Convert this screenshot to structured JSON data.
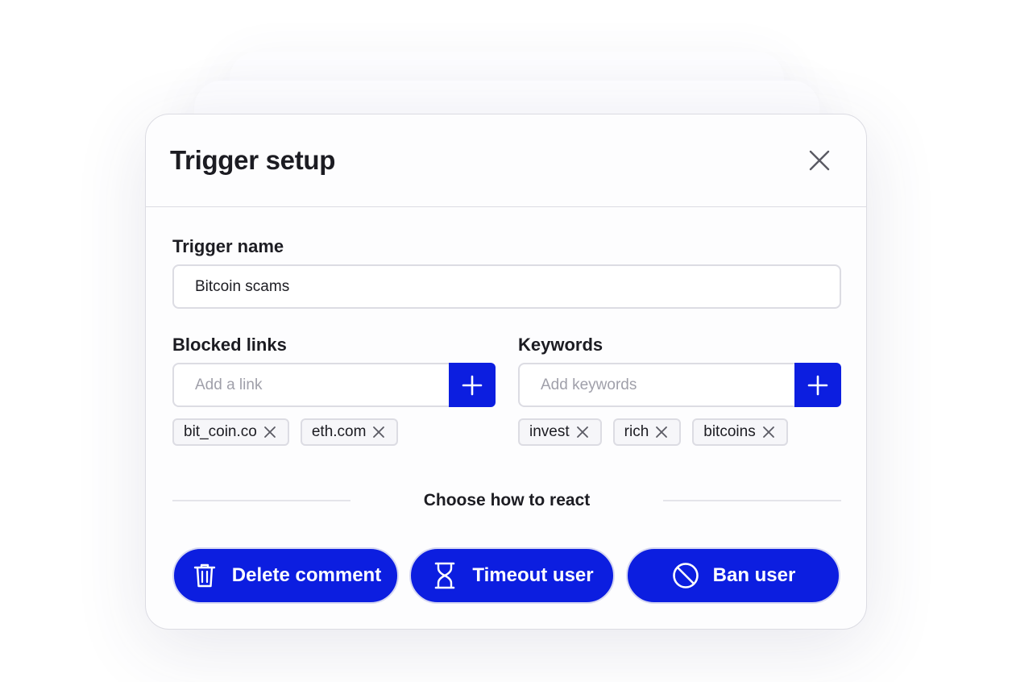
{
  "dialog": {
    "title": "Trigger setup",
    "close_icon": "close-icon"
  },
  "trigger_name": {
    "label": "Trigger name",
    "value": "Bitcoin scams"
  },
  "blocked_links": {
    "label": "Blocked links",
    "placeholder": "Add a link",
    "add_icon": "plus-icon",
    "chips": [
      "bit_coin.co",
      "eth.com"
    ]
  },
  "keywords": {
    "label": "Keywords",
    "placeholder": "Add keywords",
    "add_icon": "plus-icon",
    "chips": [
      "invest",
      "rich",
      "bitcoins"
    ]
  },
  "react": {
    "heading": "Choose how to react",
    "buttons": [
      {
        "label": "Delete comment",
        "icon": "trash-icon"
      },
      {
        "label": "Timeout user",
        "icon": "hourglass-icon"
      },
      {
        "label": "Ban user",
        "icon": "ban-icon"
      }
    ]
  },
  "colors": {
    "accent": "#0c1ee0",
    "text": "#1c1c22",
    "border": "#dcdce3",
    "chip_bg": "#f6f6f9"
  }
}
